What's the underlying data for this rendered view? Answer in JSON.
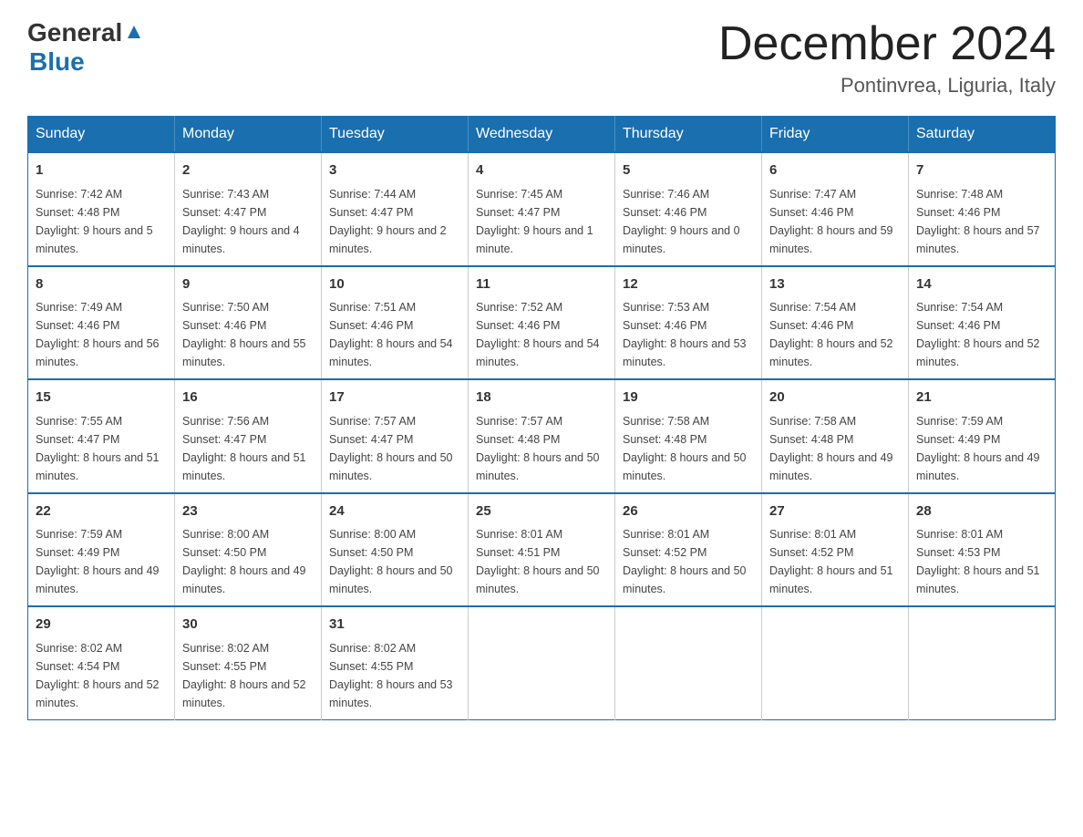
{
  "header": {
    "logo_general": "General",
    "logo_blue": "Blue",
    "title": "December 2024",
    "subtitle": "Pontinvrea, Liguria, Italy"
  },
  "days_of_week": [
    "Sunday",
    "Monday",
    "Tuesday",
    "Wednesday",
    "Thursday",
    "Friday",
    "Saturday"
  ],
  "weeks": [
    [
      {
        "day": "1",
        "sunrise": "7:42 AM",
        "sunset": "4:48 PM",
        "daylight": "9 hours and 5 minutes."
      },
      {
        "day": "2",
        "sunrise": "7:43 AM",
        "sunset": "4:47 PM",
        "daylight": "9 hours and 4 minutes."
      },
      {
        "day": "3",
        "sunrise": "7:44 AM",
        "sunset": "4:47 PM",
        "daylight": "9 hours and 2 minutes."
      },
      {
        "day": "4",
        "sunrise": "7:45 AM",
        "sunset": "4:47 PM",
        "daylight": "9 hours and 1 minute."
      },
      {
        "day": "5",
        "sunrise": "7:46 AM",
        "sunset": "4:46 PM",
        "daylight": "9 hours and 0 minutes."
      },
      {
        "day": "6",
        "sunrise": "7:47 AM",
        "sunset": "4:46 PM",
        "daylight": "8 hours and 59 minutes."
      },
      {
        "day": "7",
        "sunrise": "7:48 AM",
        "sunset": "4:46 PM",
        "daylight": "8 hours and 57 minutes."
      }
    ],
    [
      {
        "day": "8",
        "sunrise": "7:49 AM",
        "sunset": "4:46 PM",
        "daylight": "8 hours and 56 minutes."
      },
      {
        "day": "9",
        "sunrise": "7:50 AM",
        "sunset": "4:46 PM",
        "daylight": "8 hours and 55 minutes."
      },
      {
        "day": "10",
        "sunrise": "7:51 AM",
        "sunset": "4:46 PM",
        "daylight": "8 hours and 54 minutes."
      },
      {
        "day": "11",
        "sunrise": "7:52 AM",
        "sunset": "4:46 PM",
        "daylight": "8 hours and 54 minutes."
      },
      {
        "day": "12",
        "sunrise": "7:53 AM",
        "sunset": "4:46 PM",
        "daylight": "8 hours and 53 minutes."
      },
      {
        "day": "13",
        "sunrise": "7:54 AM",
        "sunset": "4:46 PM",
        "daylight": "8 hours and 52 minutes."
      },
      {
        "day": "14",
        "sunrise": "7:54 AM",
        "sunset": "4:46 PM",
        "daylight": "8 hours and 52 minutes."
      }
    ],
    [
      {
        "day": "15",
        "sunrise": "7:55 AM",
        "sunset": "4:47 PM",
        "daylight": "8 hours and 51 minutes."
      },
      {
        "day": "16",
        "sunrise": "7:56 AM",
        "sunset": "4:47 PM",
        "daylight": "8 hours and 51 minutes."
      },
      {
        "day": "17",
        "sunrise": "7:57 AM",
        "sunset": "4:47 PM",
        "daylight": "8 hours and 50 minutes."
      },
      {
        "day": "18",
        "sunrise": "7:57 AM",
        "sunset": "4:48 PM",
        "daylight": "8 hours and 50 minutes."
      },
      {
        "day": "19",
        "sunrise": "7:58 AM",
        "sunset": "4:48 PM",
        "daylight": "8 hours and 50 minutes."
      },
      {
        "day": "20",
        "sunrise": "7:58 AM",
        "sunset": "4:48 PM",
        "daylight": "8 hours and 49 minutes."
      },
      {
        "day": "21",
        "sunrise": "7:59 AM",
        "sunset": "4:49 PM",
        "daylight": "8 hours and 49 minutes."
      }
    ],
    [
      {
        "day": "22",
        "sunrise": "7:59 AM",
        "sunset": "4:49 PM",
        "daylight": "8 hours and 49 minutes."
      },
      {
        "day": "23",
        "sunrise": "8:00 AM",
        "sunset": "4:50 PM",
        "daylight": "8 hours and 49 minutes."
      },
      {
        "day": "24",
        "sunrise": "8:00 AM",
        "sunset": "4:50 PM",
        "daylight": "8 hours and 50 minutes."
      },
      {
        "day": "25",
        "sunrise": "8:01 AM",
        "sunset": "4:51 PM",
        "daylight": "8 hours and 50 minutes."
      },
      {
        "day": "26",
        "sunrise": "8:01 AM",
        "sunset": "4:52 PM",
        "daylight": "8 hours and 50 minutes."
      },
      {
        "day": "27",
        "sunrise": "8:01 AM",
        "sunset": "4:52 PM",
        "daylight": "8 hours and 51 minutes."
      },
      {
        "day": "28",
        "sunrise": "8:01 AM",
        "sunset": "4:53 PM",
        "daylight": "8 hours and 51 minutes."
      }
    ],
    [
      {
        "day": "29",
        "sunrise": "8:02 AM",
        "sunset": "4:54 PM",
        "daylight": "8 hours and 52 minutes."
      },
      {
        "day": "30",
        "sunrise": "8:02 AM",
        "sunset": "4:55 PM",
        "daylight": "8 hours and 52 minutes."
      },
      {
        "day": "31",
        "sunrise": "8:02 AM",
        "sunset": "4:55 PM",
        "daylight": "8 hours and 53 minutes."
      },
      null,
      null,
      null,
      null
    ]
  ],
  "labels": {
    "sunrise_prefix": "Sunrise: ",
    "sunset_prefix": "Sunset: ",
    "daylight_prefix": "Daylight: "
  }
}
